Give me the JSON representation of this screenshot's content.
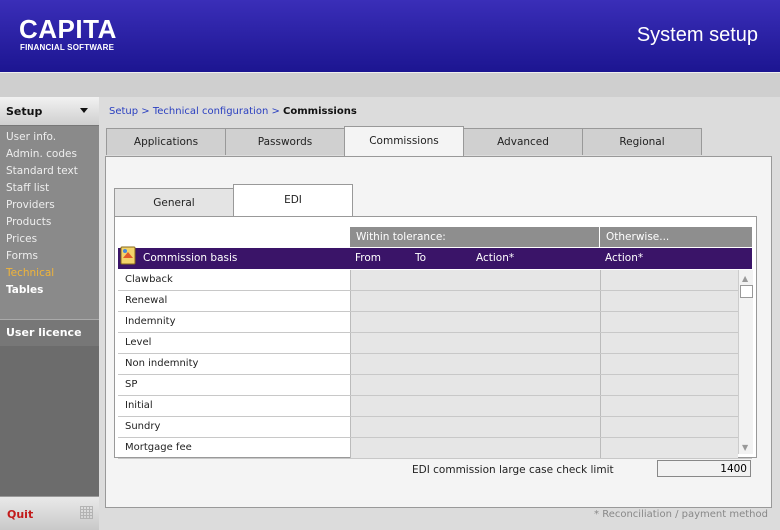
{
  "header": {
    "logo": "CAPITA",
    "logo_sub": "FINANCIAL SOFTWARE",
    "title": "System setup",
    "brand_color": "#2a20a8"
  },
  "sidebar": {
    "menu_label": "Setup",
    "items": [
      "User info.",
      "Admin. codes",
      "Standard text",
      "Staff list",
      "Providers",
      "Products",
      "Prices",
      "Forms",
      "Technical",
      "Tables"
    ],
    "active_item": "Technical",
    "licence_label": "User licence",
    "quit_label": "Quit"
  },
  "breadcrumb": {
    "part1": "Setup",
    "sep": " > ",
    "part2": "Technical configuration",
    "current": "Commissions"
  },
  "tabs": [
    "Applications",
    "Passwords",
    "Commissions",
    "Advanced",
    "Regional"
  ],
  "active_tab": "Commissions",
  "subtabs": [
    "General",
    "EDI"
  ],
  "active_subtab": "EDI",
  "grid": {
    "group_within": "Within tolerance:",
    "group_otherwise": "Otherwise...",
    "col_basis": "Commission basis",
    "col_from": "From",
    "col_to": "To",
    "col_action1": "Action*",
    "col_action2": "Action*",
    "rows": [
      "Clawback",
      "Renewal",
      "Indemnity",
      "Level",
      "Non indemnity",
      "SP",
      "Initial",
      "Sundry",
      "Mortgage fee"
    ]
  },
  "limit": {
    "label": "EDI commission large case check limit",
    "value": "1400"
  },
  "footnote": "* Reconciliation / payment method"
}
